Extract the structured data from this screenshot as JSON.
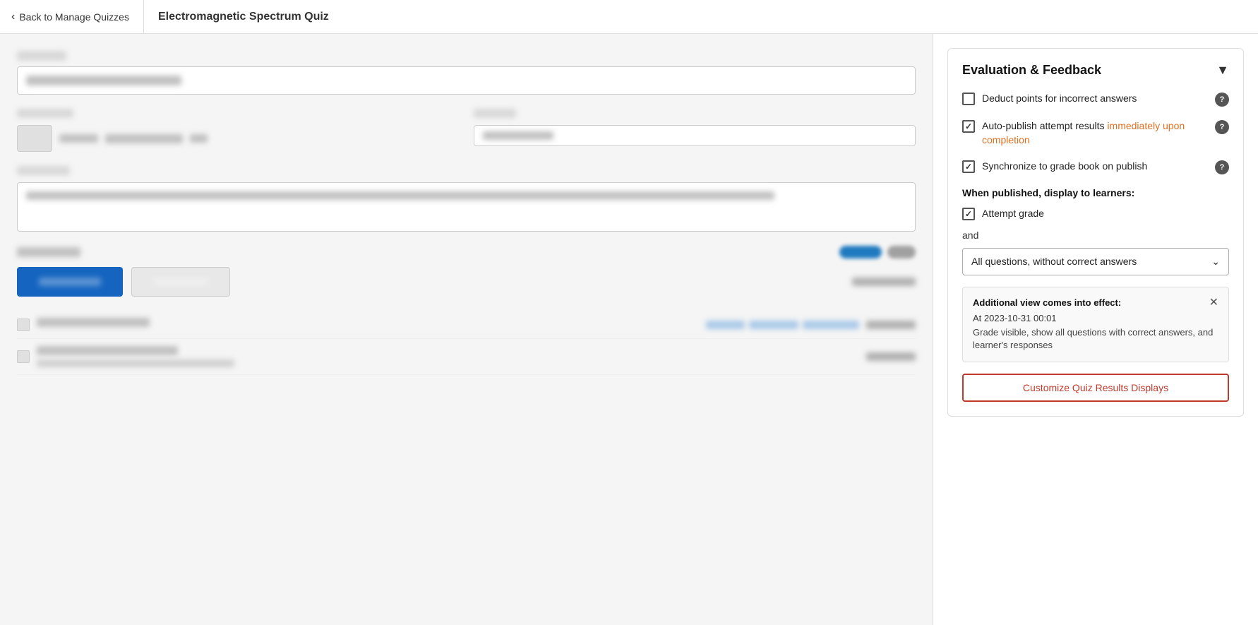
{
  "nav": {
    "back_label": "Back to Manage Quizzes",
    "page_title": "Electromagnetic Spectrum Quiz"
  },
  "sidebar": {
    "section_title": "Evaluation & Feedback",
    "options": [
      {
        "id": "deduct_points",
        "label": "Deduct points for incorrect answers",
        "checked": false,
        "has_help": true
      },
      {
        "id": "auto_publish",
        "label": "Auto-publish attempt results immediately upon completion",
        "checked": true,
        "has_help": true,
        "label_highlight": "immediately upon completion"
      },
      {
        "id": "sync_grade",
        "label": "Synchronize to grade book on publish",
        "checked": true,
        "has_help": true
      }
    ],
    "when_published_label": "When published, display to learners:",
    "attempt_grade_checked": true,
    "attempt_grade_label": "Attempt grade",
    "and_label": "and",
    "dropdown_value": "All questions, without correct answers",
    "additional_view": {
      "title": "Additional view comes into effect:",
      "date": "At 2023-10-31 00:01",
      "description": "Grade visible, show all questions with correct answers, and learner's responses"
    },
    "customize_btn_label": "Customize Quiz Results Displays"
  }
}
